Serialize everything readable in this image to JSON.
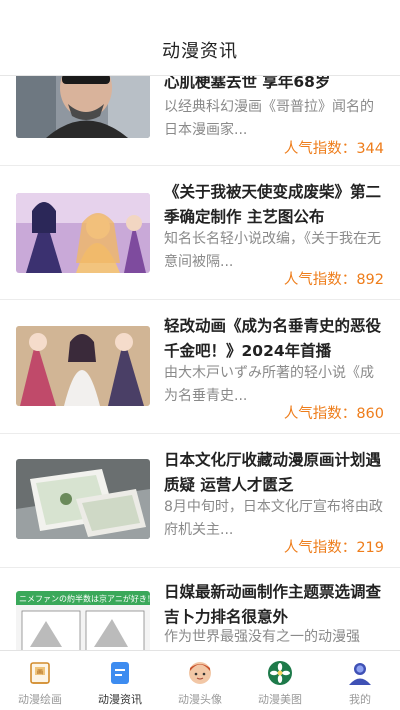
{
  "header": {
    "title": "动漫资讯"
  },
  "articles": [
    {
      "title": "心肌梗塞去世 享年68岁",
      "desc": "以经典科幻漫画《哥普拉》闻名的日本漫画家...",
      "popularity_label": "人气指数：",
      "popularity": "344"
    },
    {
      "title": "《关于我被天使变成废柴》第二季确定制作 主艺图公布",
      "desc": "知名长名轻小说改编，《关于我在无意间被隔...",
      "popularity_label": "人气指数：",
      "popularity": "892"
    },
    {
      "title": "轻改动画《成为名垂青史的恶役千金吧！》2024年首播",
      "desc": "由大木戸いずみ所著的轻小说《成为名垂青史...",
      "popularity_label": "人气指数：",
      "popularity": "860"
    },
    {
      "title": "日本文化厅收藏动漫原画计划遇质疑 运营人才匮乏",
      "desc": "8月中旬时，日本文化厅宣布将由政府机关主...",
      "popularity_label": "人气指数：",
      "popularity": "219"
    },
    {
      "title": "日媒最新动画制作主题票选调查 吉卜力排名很意外",
      "desc": "作为世界最强没有之一的动漫强",
      "popularity_label": "",
      "popularity": ""
    }
  ],
  "thumb5_banner": "ニメファンの約半数は京アニが好き！",
  "tabs": [
    {
      "label": "动漫绘画",
      "icon": "drawing-board-icon",
      "active": false
    },
    {
      "label": "动漫资讯",
      "icon": "news-document-icon",
      "active": true
    },
    {
      "label": "动漫头像",
      "icon": "avatar-face-icon",
      "active": false
    },
    {
      "label": "动漫美图",
      "icon": "flower-badge-icon",
      "active": false
    },
    {
      "label": "我的",
      "icon": "user-profile-icon",
      "active": false
    }
  ],
  "colors": {
    "accent": "#ee7d1b",
    "active_tab": "#3d8cf0"
  }
}
